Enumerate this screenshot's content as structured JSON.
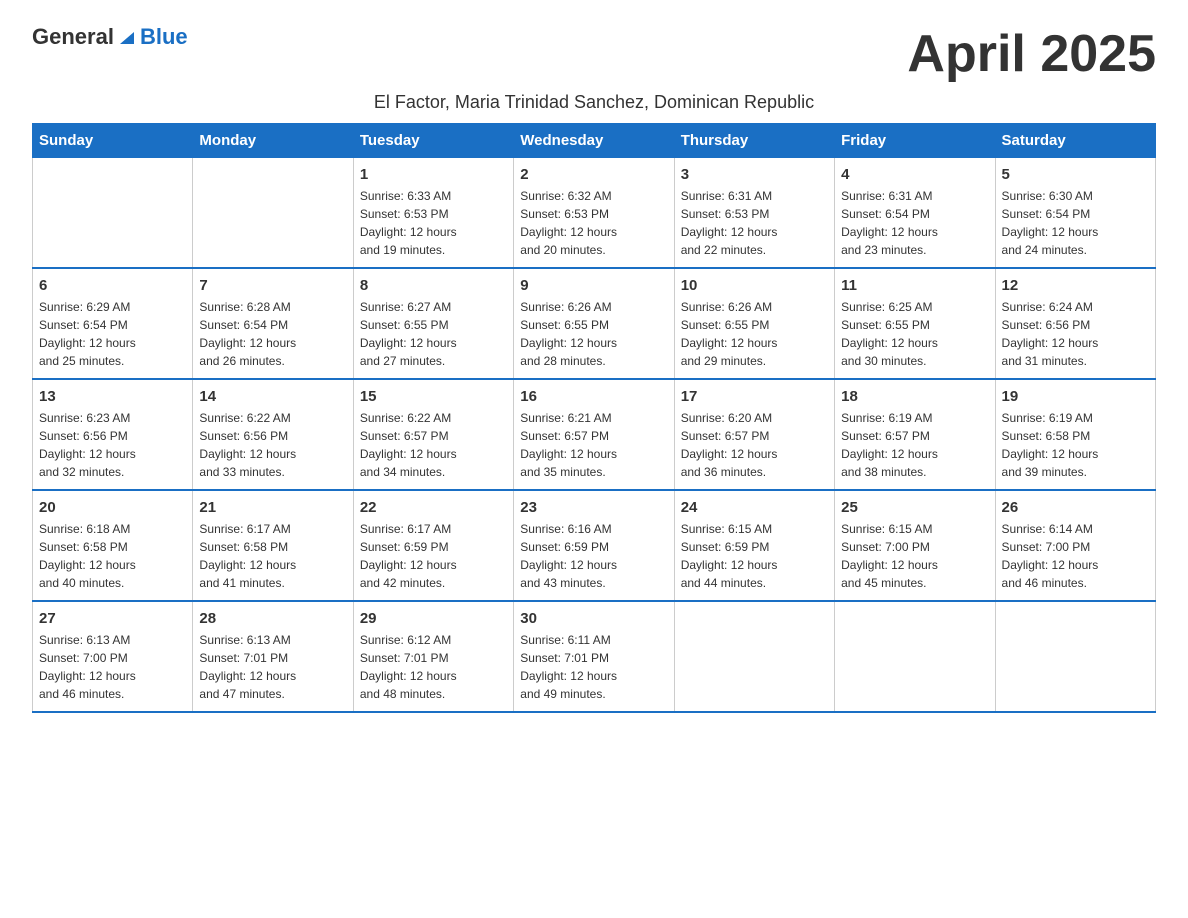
{
  "header": {
    "logo_general": "General",
    "logo_blue": "Blue",
    "month_title": "April 2025",
    "subtitle": "El Factor, Maria Trinidad Sanchez, Dominican Republic"
  },
  "days_of_week": [
    "Sunday",
    "Monday",
    "Tuesday",
    "Wednesday",
    "Thursday",
    "Friday",
    "Saturday"
  ],
  "weeks": [
    [
      {
        "day": "",
        "info": ""
      },
      {
        "day": "",
        "info": ""
      },
      {
        "day": "1",
        "info": "Sunrise: 6:33 AM\nSunset: 6:53 PM\nDaylight: 12 hours\nand 19 minutes."
      },
      {
        "day": "2",
        "info": "Sunrise: 6:32 AM\nSunset: 6:53 PM\nDaylight: 12 hours\nand 20 minutes."
      },
      {
        "day": "3",
        "info": "Sunrise: 6:31 AM\nSunset: 6:53 PM\nDaylight: 12 hours\nand 22 minutes."
      },
      {
        "day": "4",
        "info": "Sunrise: 6:31 AM\nSunset: 6:54 PM\nDaylight: 12 hours\nand 23 minutes."
      },
      {
        "day": "5",
        "info": "Sunrise: 6:30 AM\nSunset: 6:54 PM\nDaylight: 12 hours\nand 24 minutes."
      }
    ],
    [
      {
        "day": "6",
        "info": "Sunrise: 6:29 AM\nSunset: 6:54 PM\nDaylight: 12 hours\nand 25 minutes."
      },
      {
        "day": "7",
        "info": "Sunrise: 6:28 AM\nSunset: 6:54 PM\nDaylight: 12 hours\nand 26 minutes."
      },
      {
        "day": "8",
        "info": "Sunrise: 6:27 AM\nSunset: 6:55 PM\nDaylight: 12 hours\nand 27 minutes."
      },
      {
        "day": "9",
        "info": "Sunrise: 6:26 AM\nSunset: 6:55 PM\nDaylight: 12 hours\nand 28 minutes."
      },
      {
        "day": "10",
        "info": "Sunrise: 6:26 AM\nSunset: 6:55 PM\nDaylight: 12 hours\nand 29 minutes."
      },
      {
        "day": "11",
        "info": "Sunrise: 6:25 AM\nSunset: 6:55 PM\nDaylight: 12 hours\nand 30 minutes."
      },
      {
        "day": "12",
        "info": "Sunrise: 6:24 AM\nSunset: 6:56 PM\nDaylight: 12 hours\nand 31 minutes."
      }
    ],
    [
      {
        "day": "13",
        "info": "Sunrise: 6:23 AM\nSunset: 6:56 PM\nDaylight: 12 hours\nand 32 minutes."
      },
      {
        "day": "14",
        "info": "Sunrise: 6:22 AM\nSunset: 6:56 PM\nDaylight: 12 hours\nand 33 minutes."
      },
      {
        "day": "15",
        "info": "Sunrise: 6:22 AM\nSunset: 6:57 PM\nDaylight: 12 hours\nand 34 minutes."
      },
      {
        "day": "16",
        "info": "Sunrise: 6:21 AM\nSunset: 6:57 PM\nDaylight: 12 hours\nand 35 minutes."
      },
      {
        "day": "17",
        "info": "Sunrise: 6:20 AM\nSunset: 6:57 PM\nDaylight: 12 hours\nand 36 minutes."
      },
      {
        "day": "18",
        "info": "Sunrise: 6:19 AM\nSunset: 6:57 PM\nDaylight: 12 hours\nand 38 minutes."
      },
      {
        "day": "19",
        "info": "Sunrise: 6:19 AM\nSunset: 6:58 PM\nDaylight: 12 hours\nand 39 minutes."
      }
    ],
    [
      {
        "day": "20",
        "info": "Sunrise: 6:18 AM\nSunset: 6:58 PM\nDaylight: 12 hours\nand 40 minutes."
      },
      {
        "day": "21",
        "info": "Sunrise: 6:17 AM\nSunset: 6:58 PM\nDaylight: 12 hours\nand 41 minutes."
      },
      {
        "day": "22",
        "info": "Sunrise: 6:17 AM\nSunset: 6:59 PM\nDaylight: 12 hours\nand 42 minutes."
      },
      {
        "day": "23",
        "info": "Sunrise: 6:16 AM\nSunset: 6:59 PM\nDaylight: 12 hours\nand 43 minutes."
      },
      {
        "day": "24",
        "info": "Sunrise: 6:15 AM\nSunset: 6:59 PM\nDaylight: 12 hours\nand 44 minutes."
      },
      {
        "day": "25",
        "info": "Sunrise: 6:15 AM\nSunset: 7:00 PM\nDaylight: 12 hours\nand 45 minutes."
      },
      {
        "day": "26",
        "info": "Sunrise: 6:14 AM\nSunset: 7:00 PM\nDaylight: 12 hours\nand 46 minutes."
      }
    ],
    [
      {
        "day": "27",
        "info": "Sunrise: 6:13 AM\nSunset: 7:00 PM\nDaylight: 12 hours\nand 46 minutes."
      },
      {
        "day": "28",
        "info": "Sunrise: 6:13 AM\nSunset: 7:01 PM\nDaylight: 12 hours\nand 47 minutes."
      },
      {
        "day": "29",
        "info": "Sunrise: 6:12 AM\nSunset: 7:01 PM\nDaylight: 12 hours\nand 48 minutes."
      },
      {
        "day": "30",
        "info": "Sunrise: 6:11 AM\nSunset: 7:01 PM\nDaylight: 12 hours\nand 49 minutes."
      },
      {
        "day": "",
        "info": ""
      },
      {
        "day": "",
        "info": ""
      },
      {
        "day": "",
        "info": ""
      }
    ]
  ]
}
